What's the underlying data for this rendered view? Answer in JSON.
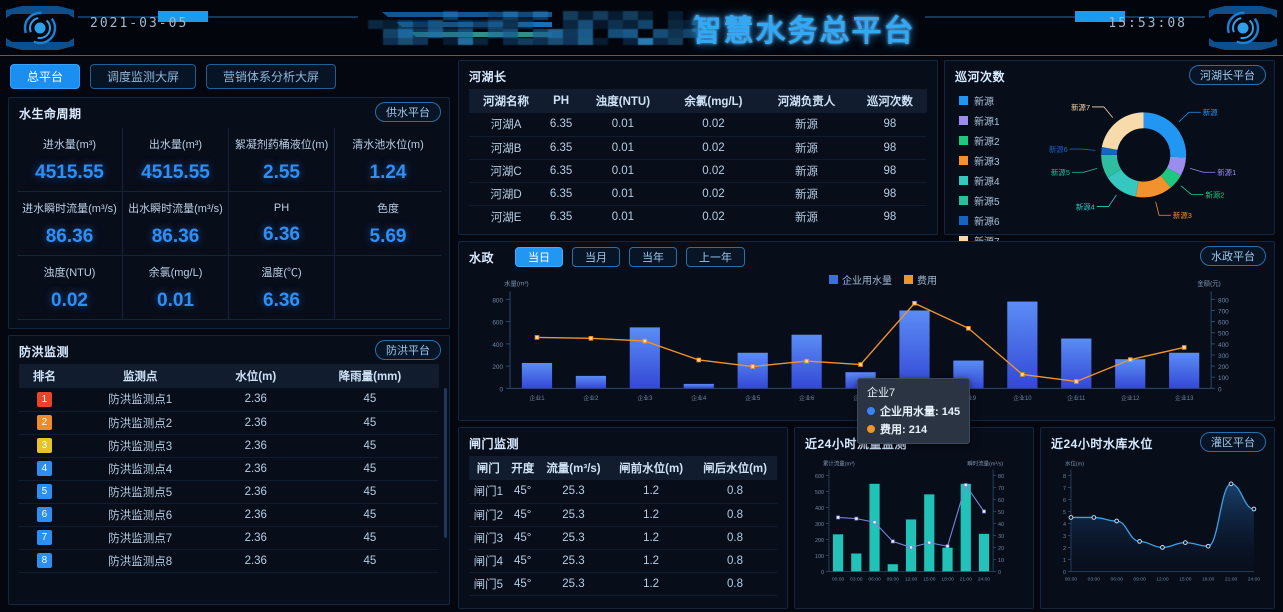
{
  "header": {
    "date": "2021-03-05",
    "time": "15:53:08",
    "title": "智慧水务总平台",
    "logo_icon": "eye-emblem-icon"
  },
  "nav": {
    "items": [
      {
        "label": "总平台",
        "active": true
      },
      {
        "label": "调度监测大屏",
        "active": false
      },
      {
        "label": "营销体系分析大屏",
        "active": false
      }
    ]
  },
  "water_lifecycle": {
    "title": "水生命周期",
    "platform_button": "供水平台",
    "metrics": [
      {
        "label": "进水量(m³)",
        "value": "4515.55"
      },
      {
        "label": "出水量(m³)",
        "value": "4515.55"
      },
      {
        "label": "絮凝剂药桶液位(m)",
        "value": "2.55"
      },
      {
        "label": "清水池水位(m)",
        "value": "1.24"
      },
      {
        "label": "进水瞬时流量(m³/s)",
        "value": "86.36"
      },
      {
        "label": "出水瞬时流量(m³/s)",
        "value": "86.36"
      },
      {
        "label": "PH",
        "value": "6.36"
      },
      {
        "label": "色度",
        "value": "5.69"
      },
      {
        "label": "浊度(NTU)",
        "value": "0.02"
      },
      {
        "label": "余氯(mg/L)",
        "value": "0.01"
      },
      {
        "label": "温度(℃)",
        "value": "6.36"
      },
      {
        "label": "",
        "value": ""
      }
    ]
  },
  "flood_monitor": {
    "title": "防洪监测",
    "platform_button": "防洪平台",
    "columns": [
      "排名",
      "监测点",
      "水位(m)",
      "降雨量(mm)"
    ],
    "rows": [
      {
        "rank": "1",
        "point": "防洪监测点1",
        "level": "2.36",
        "rain": "45",
        "color": "#e8442a"
      },
      {
        "rank": "2",
        "point": "防洪监测点2",
        "level": "2.36",
        "rain": "45",
        "color": "#f08b2a"
      },
      {
        "rank": "3",
        "point": "防洪监测点3",
        "level": "2.36",
        "rain": "45",
        "color": "#e8c22a"
      },
      {
        "rank": "4",
        "point": "防洪监测点4",
        "level": "2.36",
        "rain": "45",
        "color": "#2b8ef0"
      },
      {
        "rank": "5",
        "point": "防洪监测点5",
        "level": "2.36",
        "rain": "45",
        "color": "#2b8ef0"
      },
      {
        "rank": "6",
        "point": "防洪监测点6",
        "level": "2.36",
        "rain": "45",
        "color": "#2b8ef0"
      },
      {
        "rank": "7",
        "point": "防洪监测点7",
        "level": "2.36",
        "rain": "45",
        "color": "#2b8ef0"
      },
      {
        "rank": "8",
        "point": "防洪监测点8",
        "level": "2.36",
        "rain": "45",
        "color": "#2b8ef0"
      }
    ]
  },
  "river_chief": {
    "title": "河湖长",
    "columns": [
      "河湖名称",
      "PH",
      "浊度(NTU)",
      "余氯(mg/L)",
      "河湖负责人",
      "巡河次数"
    ],
    "rows": [
      {
        "name": "河湖A",
        "ph": "6.35",
        "ntu": "0.01",
        "cl": "0.02",
        "owner": "新源",
        "patrols": "98"
      },
      {
        "name": "河湖B",
        "ph": "6.35",
        "ntu": "0.01",
        "cl": "0.02",
        "owner": "新源",
        "patrols": "98"
      },
      {
        "name": "河湖C",
        "ph": "6.35",
        "ntu": "0.01",
        "cl": "0.02",
        "owner": "新源",
        "patrols": "98"
      },
      {
        "name": "河湖D",
        "ph": "6.35",
        "ntu": "0.01",
        "cl": "0.02",
        "owner": "新源",
        "patrols": "98"
      },
      {
        "name": "河湖E",
        "ph": "6.35",
        "ntu": "0.01",
        "cl": "0.02",
        "owner": "新源",
        "patrols": "98"
      }
    ]
  },
  "patrol_counts": {
    "title": "巡河次数",
    "platform_button": "河湖长平台"
  },
  "water_affairs": {
    "title": "水政",
    "platform_button": "水政平台",
    "tabs": [
      {
        "label": "当日",
        "active": true
      },
      {
        "label": "当月",
        "active": false
      },
      {
        "label": "当年",
        "active": false
      },
      {
        "label": "上一年",
        "active": false
      }
    ],
    "tooltip": {
      "title": "企业7",
      "rows": [
        {
          "label": "企业用水量",
          "value": "145",
          "color": "#3b82f6"
        },
        {
          "label": "费用",
          "value": "214",
          "color": "#f0932b"
        }
      ]
    }
  },
  "gate_monitor": {
    "title": "闸门监测",
    "columns": [
      "闸门",
      "开度",
      "流量(m³/s)",
      "闸前水位(m)",
      "闸后水位(m)"
    ],
    "rows": [
      {
        "gate": "闸门1",
        "opening": "45°",
        "flow": "25.3",
        "front": "1.2",
        "back": "0.8"
      },
      {
        "gate": "闸门2",
        "opening": "45°",
        "flow": "25.3",
        "front": "1.2",
        "back": "0.8"
      },
      {
        "gate": "闸门3",
        "opening": "45°",
        "flow": "25.3",
        "front": "1.2",
        "back": "0.8"
      },
      {
        "gate": "闸门4",
        "opening": "45°",
        "flow": "25.3",
        "front": "1.2",
        "back": "0.8"
      },
      {
        "gate": "闸门5",
        "opening": "45°",
        "flow": "25.3",
        "front": "1.2",
        "back": "0.8"
      }
    ]
  },
  "flow_24h": {
    "title": "近24小时流量监测"
  },
  "reservoir_24h": {
    "title": "近24小时水库水位",
    "platform_button": "灌区平台"
  },
  "chart_data": [
    {
      "id": "water_affairs_chart",
      "type": "bar",
      "title": "水政 - 当日",
      "categories": [
        "企业1",
        "企业2",
        "企业3",
        "企业4",
        "企业5",
        "企业6",
        "企业7",
        "企业8",
        "企业9",
        "企业10",
        "企业11",
        "企业12",
        "企业13"
      ],
      "series": [
        {
          "name": "企业用水量",
          "type": "bar",
          "color": "#3b6fe0",
          "values": [
            228,
            112,
            548,
            40,
            320,
            482,
            145,
            700,
            250,
            780,
            448,
            262,
            320
          ]
        },
        {
          "name": "费用",
          "type": "line",
          "color": "#f0932b",
          "values": [
            458,
            450,
            425,
            255,
            196,
            245,
            214,
            765,
            540,
            125,
            62,
            258,
            368
          ]
        }
      ],
      "ylabel": "水量(m³)",
      "y2label": "金额(元)",
      "ylim": [
        0,
        800
      ],
      "y2lim": [
        0,
        800
      ],
      "yticks": [
        0,
        200,
        400,
        600,
        800
      ],
      "y2ticks": [
        0,
        100,
        200,
        300,
        400,
        500,
        600,
        700,
        800
      ],
      "grid": false,
      "legend_position": "top-right"
    },
    {
      "id": "patrol_donut",
      "type": "pie",
      "title": "巡河次数",
      "labels": [
        "新源",
        "新源1",
        "新源2",
        "新源3",
        "新源4",
        "新源5",
        "新源6",
        "新源7"
      ],
      "values": [
        26,
        7,
        6,
        14,
        13,
        9,
        3,
        22
      ],
      "colors": [
        "#2196f3",
        "#9b8cf0",
        "#1ec97f",
        "#f2922e",
        "#35c7c0",
        "#2ebd9e",
        "#1565c0",
        "#f7dbab"
      ],
      "legend_position": "left"
    },
    {
      "id": "flow_24h_chart",
      "type": "bar",
      "title": "近24小时流量监测",
      "categories": [
        "00:00",
        "03:00",
        "06:00",
        "09:00",
        "12:00",
        "15:00",
        "18:00",
        "21:00",
        "24:00"
      ],
      "series": [
        {
          "name": "累计流量",
          "type": "bar",
          "color": "#21c2b8",
          "values": [
            232,
            112,
            548,
            45,
            325,
            482,
            148,
            548,
            235
          ]
        },
        {
          "name": "瞬时流量",
          "type": "line",
          "color": "#7b86d6",
          "values": [
            45,
            44,
            41,
            25,
            20,
            24,
            21,
            72,
            50
          ]
        }
      ],
      "ylabel": "累计流量(m³)",
      "y2label": "瞬时流量(m³/s)",
      "ylim": [
        0,
        600
      ],
      "y2lim": [
        0,
        80
      ],
      "yticks": [
        0,
        100,
        200,
        300,
        400,
        500,
        600
      ],
      "y2ticks": [
        0,
        10,
        20,
        30,
        40,
        50,
        60,
        70,
        80
      ],
      "grid": false
    },
    {
      "id": "reservoir_level_chart",
      "type": "area",
      "title": "近24小时水库水位",
      "categories": [
        "00:00",
        "03:00",
        "06:00",
        "09:00",
        "12:00",
        "15:00",
        "18:00",
        "21:00",
        "24:00"
      ],
      "series": [
        {
          "name": "水位",
          "color": "#3ba0e8",
          "values": [
            4.5,
            4.5,
            4.2,
            2.5,
            2.0,
            2.4,
            2.1,
            7.3,
            5.2
          ]
        }
      ],
      "ylabel": "水位(m)",
      "ylim": [
        0,
        8
      ],
      "yticks": [
        0,
        1,
        2,
        3,
        4,
        5,
        6,
        7,
        8
      ],
      "grid": false
    }
  ]
}
